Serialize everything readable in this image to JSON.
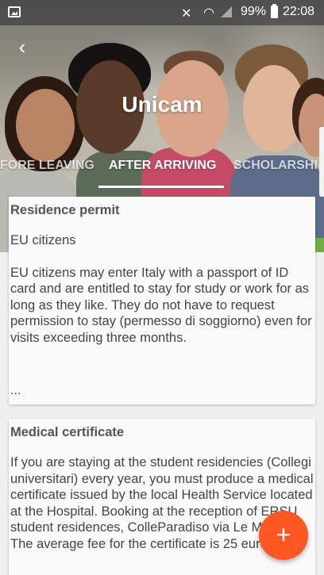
{
  "status_bar": {
    "gallery_icon": "image-icon",
    "mute_icon": "mute-icon",
    "wifi_icon": "wifi-icon",
    "signal_icon": "signal-icon",
    "battery_percent": "99%",
    "battery_icon": "battery-icon",
    "time": "22:08"
  },
  "header": {
    "back_icon": "back-arrow-icon",
    "back_glyph": "‹",
    "title": "Unicam"
  },
  "tabs": [
    {
      "label": "FORE LEAVING",
      "active": false
    },
    {
      "label": "AFTER ARRIVING",
      "active": true
    },
    {
      "label": "SCHOLARSHI",
      "active": false
    }
  ],
  "cards": [
    {
      "title": "Residence permit",
      "paragraphs": [
        "EU citizens",
        "EU citizens may enter Italy with a passport of ID card and are entitled to stay for study or work for as long as they like. They do not have to request permission to stay (permesso di soggiorno) even for visits exceeding three months."
      ],
      "more": "..."
    },
    {
      "title": "Medical certificate",
      "paragraphs": [
        "If you are staying at the student residencies (Collegi universitari) every year, you must produce a medical certificate issued by the local Health Service located at the Hospital. Booking at the reception of ERSU student residences, ColleParadiso via Le Mosse. The average fee for the certificate is 25 euros."
      ]
    }
  ],
  "fab": {
    "icon": "plus-icon",
    "glyph": "+"
  },
  "colors": {
    "accent": "#ff5722",
    "card_background": "#fafafa",
    "page_background": "#efefef"
  }
}
